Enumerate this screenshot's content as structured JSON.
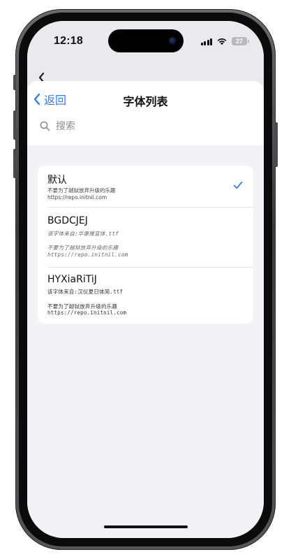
{
  "status_bar": {
    "time": "12:18",
    "battery": "27"
  },
  "nav": {
    "back_label": "返回",
    "title": "字体列表"
  },
  "search": {
    "placeholder": "搜索"
  },
  "fonts": [
    {
      "name": "默认",
      "line1": "不要为了越狱放弃升级的乐趣",
      "line2": "https://repo.initnil.com",
      "selected": true
    },
    {
      "name": "BGDCJEJ",
      "file_line": "该字体来自:华康雅蓝体.ttf",
      "line1": "不要为了越狱放弃升级的乐趣",
      "line2": "https://repo.initnil.com"
    },
    {
      "name": "HYXiaRiTiJ",
      "file_line": "该字体来自:汉仪夏日体简.ttf",
      "line1": "不要为了越狱放弃升级的乐趣",
      "line2": "https://repo.initnil.com"
    }
  ],
  "colors": {
    "accent": "#2f7cf6",
    "background": "#f2f2f7",
    "card": "#ffffff"
  },
  "icons": {
    "back_top": "chevron-left-icon",
    "back_nav": "chevron-left-icon",
    "search": "search-icon",
    "selected": "checkmark-icon"
  }
}
